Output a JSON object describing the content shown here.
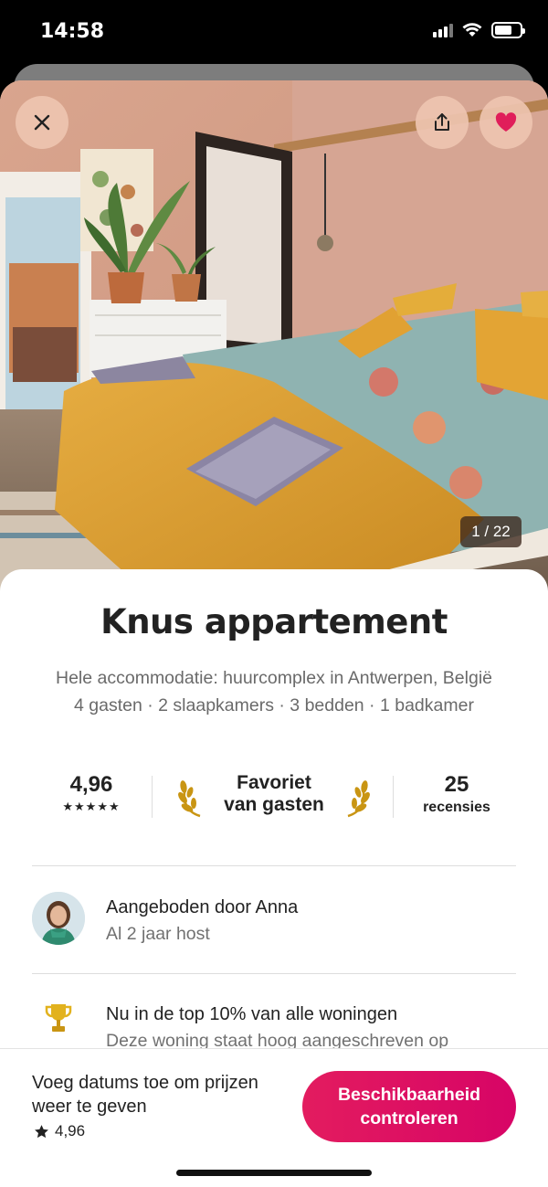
{
  "status_bar": {
    "time": "14:58"
  },
  "photo": {
    "counter": "1 / 22"
  },
  "listing": {
    "title": "Knus appartement",
    "subtitle_line1": "Hele accommodatie: huurcomplex in Antwerpen, België",
    "subtitle_line2": "4 gasten · 2 slaapkamers · 3 bedden · 1 badkamer"
  },
  "stats": {
    "rating": "4,96",
    "stars": "★★★★★",
    "favorite_line1": "Favoriet",
    "favorite_line2": "van gasten",
    "reviews_count": "25",
    "reviews_label": "recensies"
  },
  "host": {
    "title": "Aangeboden door Anna",
    "subtitle": "Al 2 jaar host"
  },
  "highlight": {
    "title": "Nu in de top 10% van alle woningen",
    "subtitle": "Deze woning staat hoog aangeschreven op"
  },
  "footer": {
    "line1": "Voeg datums toe om prijzen",
    "line2": "weer te geven",
    "rating": "4,96",
    "cta_line1": "Beschikbaarheid",
    "cta_line2": "controleren"
  },
  "colors": {
    "accent": "#e31c5f",
    "heart": "#e01e5a",
    "text": "#222222",
    "muted": "#717171"
  },
  "icons": [
    "close-icon",
    "share-icon",
    "heart-icon",
    "laurel-icon",
    "trophy-icon",
    "star-icon"
  ]
}
